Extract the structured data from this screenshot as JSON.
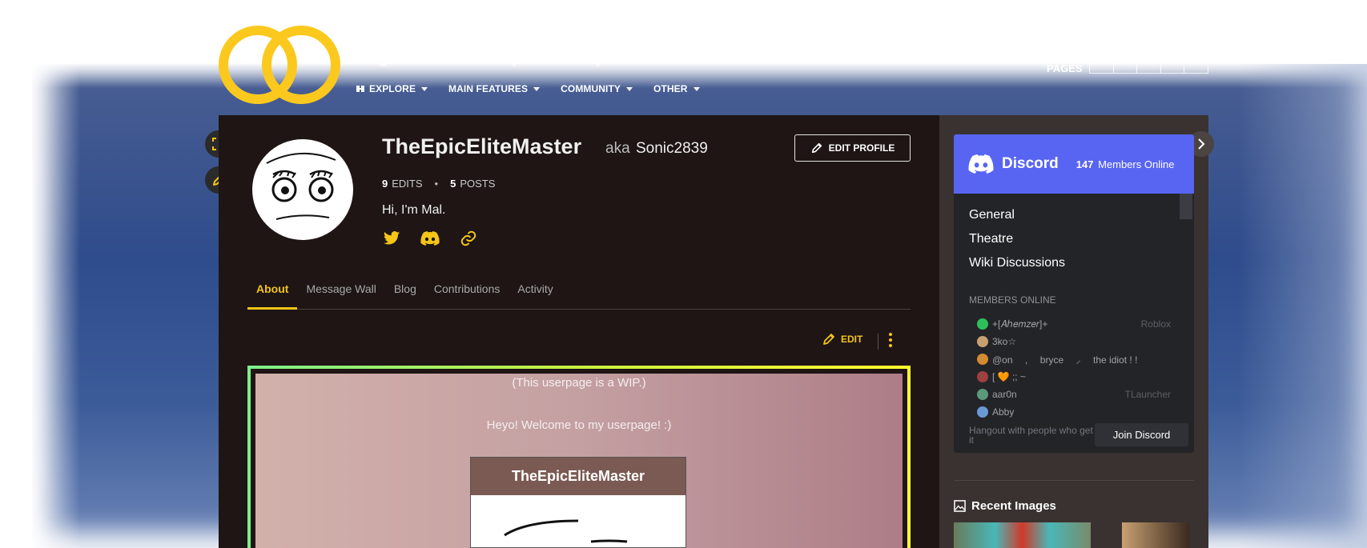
{
  "header": {
    "wiki_title": "Regretevator Wiki (Unofficial)",
    "nav": [
      {
        "label": "EXPLORE",
        "icon": "explore-icon"
      },
      {
        "label": "MAIN FEATURES"
      },
      {
        "label": "COMMUNITY"
      },
      {
        "label": "OTHER"
      }
    ],
    "pages_label": "PAGES"
  },
  "profile": {
    "username": "TheEpicEliteMaster",
    "aka_label": "aka",
    "aka_name": "Sonic2839",
    "edit_profile_label": "EDIT PROFILE",
    "edits_count": "9",
    "edits_label": "EDITS",
    "posts_count": "5",
    "posts_label": "POSTS",
    "bio": "Hi, I'm Mal.",
    "socials": [
      "twitter-icon",
      "discord-icon",
      "link-icon"
    ]
  },
  "tabs": [
    {
      "label": "About",
      "active": true
    },
    {
      "label": "Message Wall",
      "active": false
    },
    {
      "label": "Blog",
      "active": false
    },
    {
      "label": "Contributions",
      "active": false
    },
    {
      "label": "Activity",
      "active": false
    }
  ],
  "page_actions": {
    "edit_label": "EDIT"
  },
  "userpage": {
    "wip_note": "(This userpage is a WIP.)",
    "welcome": "Heyo! Welcome to my userpage! :)",
    "infobox_title": "TheEpicEliteMaster"
  },
  "discord": {
    "brand": "Discord",
    "online_count": "147",
    "online_label": "Members Online",
    "channels": [
      "General",
      "Theatre",
      "Wiki Discussions"
    ],
    "members_label": "MEMBERS ONLINE",
    "members": [
      {
        "name": "+[𝐴ℎ𝑒𝑚𝑧𝑒𝑟]+",
        "game": "Roblox",
        "color": "#2fbf5a"
      },
      {
        "name": "3ko☆",
        "game": "",
        "color": "#c8a070"
      },
      {
        "name": "@on ⠀ , ⠀ bryce ⠀ ⸝ ⠀ the idiot ! !",
        "game": "",
        "color": "#d48a30"
      },
      {
        "name": "[ 🧡 ;; ~",
        "game": "",
        "color": "#a04040"
      },
      {
        "name": "aar0n",
        "game": "TLauncher",
        "color": "#5a9a7a"
      },
      {
        "name": "Abby",
        "game": "",
        "color": "#6a9ad4"
      }
    ],
    "footer_text": "Hangout with people who get it",
    "join_label": "Join Discord"
  },
  "recent_images": {
    "title": "Recent Images"
  },
  "colors": {
    "accent": "#f5c518",
    "page_bg": "#1e1514",
    "rail_bg": "#3a3230",
    "discord_blurple": "#5865f2"
  }
}
